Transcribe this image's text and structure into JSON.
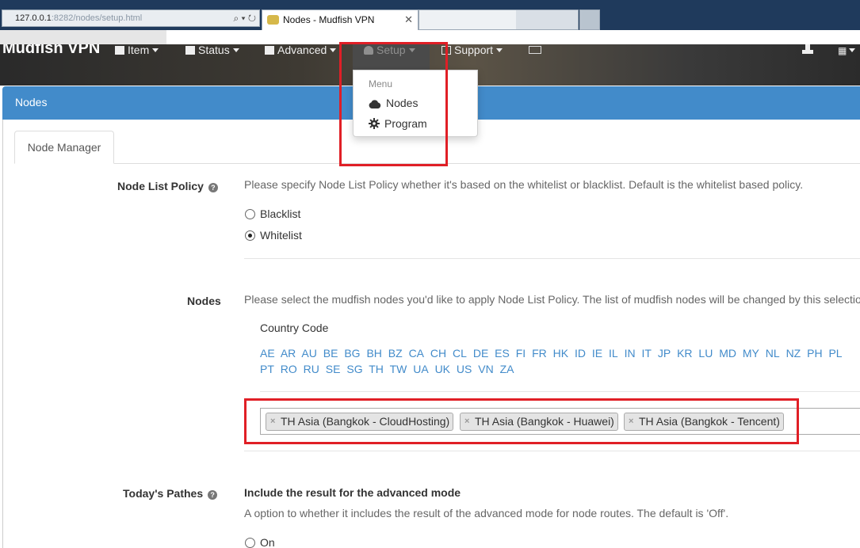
{
  "browser": {
    "address_host": "127.0.0.1",
    "address_path": ":8282/nodes/setup.html",
    "active_tab_title": "Nodes - Mudfish VPN",
    "tab_close": "✕",
    "addr_controls": "⌕ ▾ ↻"
  },
  "navbar": {
    "brand": "Mudfish VPN",
    "items": [
      {
        "label": "Item"
      },
      {
        "label": "Status"
      },
      {
        "label": "Advanced"
      },
      {
        "label": "Setup"
      },
      {
        "label": "Support"
      }
    ]
  },
  "dropdown": {
    "header": "Menu",
    "items": [
      {
        "label": "Nodes",
        "icon": "cloud-icon"
      },
      {
        "label": "Program",
        "icon": "gear-icon"
      }
    ]
  },
  "panel": {
    "title": "Nodes"
  },
  "tabs": {
    "active": "Node Manager"
  },
  "node_list_policy": {
    "label": "Node List Policy",
    "help": "?",
    "description": "Please specify Node List Policy whether it's based on the whitelist or blacklist. Default is the whitelist based policy.",
    "options": [
      {
        "label": "Blacklist",
        "selected": false
      },
      {
        "label": "Whitelist",
        "selected": true
      }
    ]
  },
  "nodes": {
    "label": "Nodes",
    "description": "Please select the mudfish nodes you'd like to apply Node List Policy. The list of mudfish nodes will be changed by this selectio",
    "country_code_title": "Country Code",
    "country_codes": [
      "AE",
      "AR",
      "AU",
      "BE",
      "BG",
      "BH",
      "BZ",
      "CA",
      "CH",
      "CL",
      "DE",
      "ES",
      "FI",
      "FR",
      "HK",
      "ID",
      "IE",
      "IL",
      "IN",
      "IT",
      "JP",
      "KR",
      "LU",
      "MD",
      "MY",
      "NL",
      "NZ",
      "PH",
      "PL",
      "PT",
      "RO",
      "RU",
      "SE",
      "SG",
      "TH",
      "TW",
      "UA",
      "UK",
      "US",
      "VN",
      "ZA"
    ],
    "selected": [
      {
        "label": "TH Asia (Bangkok - CloudHosting)",
        "remove": "×"
      },
      {
        "label": "TH Asia (Bangkok - Huawei)",
        "remove": "×"
      },
      {
        "label": "TH Asia (Bangkok - Tencent)",
        "remove": "×"
      }
    ]
  },
  "todays_pathes": {
    "label": "Today's Pathes",
    "help": "?",
    "subtitle": "Include the result for the advanced mode",
    "description": "A option to whether it includes the result of the advanced mode for node routes. The default is 'Off'.",
    "options": [
      {
        "label": "On",
        "selected": false
      }
    ]
  },
  "colors": {
    "accent": "#428bca",
    "highlight": "#e01f26"
  }
}
